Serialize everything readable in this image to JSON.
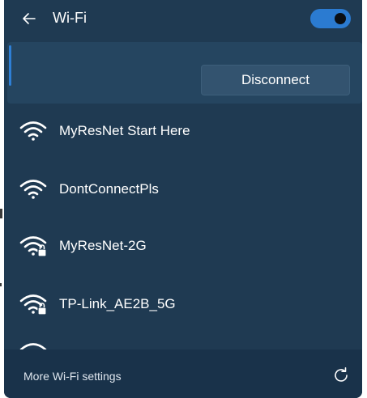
{
  "header": {
    "title": "Wi-Fi",
    "back_icon": "arrow-left-icon",
    "toggle_state": "on"
  },
  "connected": {
    "disconnect_label": "Disconnect"
  },
  "networks": [
    {
      "name": "MyResNet Start Here",
      "secured": false
    },
    {
      "name": "DontConnectPls",
      "secured": false
    },
    {
      "name": "MyResNet-2G",
      "secured": true
    },
    {
      "name": "TP-Link_AE2B_5G",
      "secured": true
    }
  ],
  "footer": {
    "more_settings_label": "More Wi-Fi settings",
    "refresh_icon": "refresh-icon"
  },
  "colors": {
    "panel_bg": "#1f3a52",
    "accent": "#2e7fd6",
    "toggle_on": "#2b7bd1"
  }
}
